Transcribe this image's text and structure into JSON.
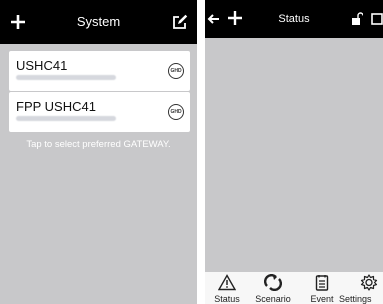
{
  "left_screen": {
    "title": "System",
    "icons": [
      "plus-icon",
      "edit-icon"
    ],
    "gateways": [
      {
        "name": "USHC41",
        "badge": "GHD"
      },
      {
        "name": "FPP USHC41",
        "badge": "GHD"
      }
    ],
    "hint": "Tap to select preferred GATEWAY."
  },
  "right_screen": {
    "title": "Status",
    "icons": [
      "back-icon",
      "plus-icon",
      "lock-icon",
      "window-icon"
    ],
    "tabs": [
      {
        "label": "Status",
        "icon": "warning-icon"
      },
      {
        "label": "Scenario",
        "icon": "scenario-icon"
      },
      {
        "label": "Event",
        "icon": "event-icon"
      },
      {
        "label": "Settings",
        "icon": "gear-icon"
      }
    ]
  },
  "colors": {
    "bar": "#000000",
    "content": "#c8c8ca",
    "tabbar": "#f7f7f7"
  }
}
